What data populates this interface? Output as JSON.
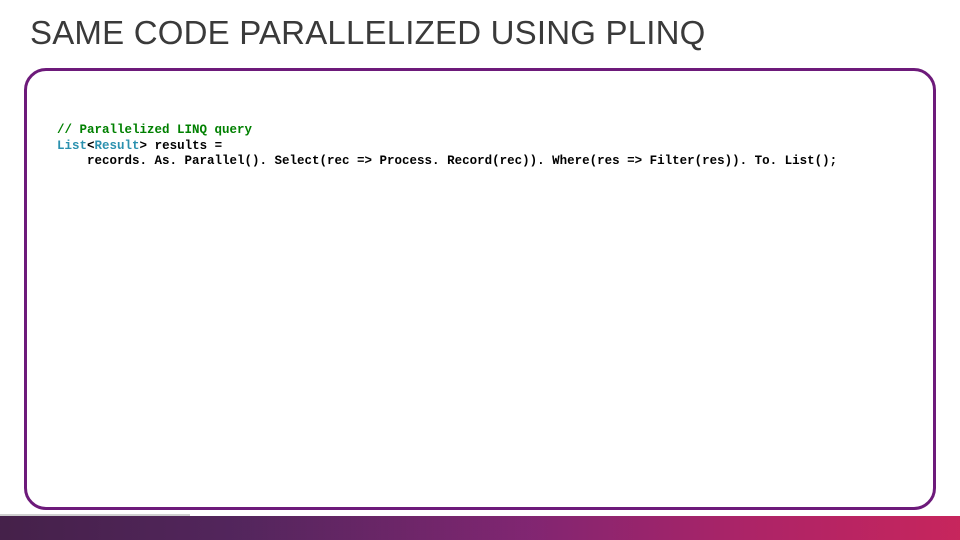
{
  "title": "SAME CODE PARALLELIZED USING PLINQ",
  "code": {
    "comment": "// Parallelized LINQ query",
    "line2_pre": "List",
    "line2_generic_open": "<",
    "line2_type": "Result",
    "line2_generic_close": ">",
    "line2_rest": " results =",
    "line3": "    records. As. Parallel(). Select(rec => Process. Record(rec)). Where(res => Filter(res)). To. List();"
  }
}
